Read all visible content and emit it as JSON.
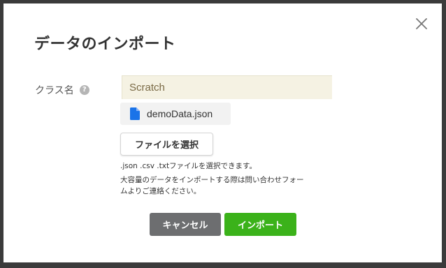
{
  "dialog": {
    "title": "データのインポート",
    "close_icon": "close-icon"
  },
  "form": {
    "class_name_label": "クラス名",
    "help_icon_text": "?",
    "class_name_value": "Scratch",
    "file": {
      "icon": "file-icon",
      "icon_color": "#1a73e8",
      "name": "demoData.json"
    },
    "choose_file_label": "ファイルを選択",
    "hint_formats": ".json .csv .txtファイルを選択できます。",
    "hint_contact_line1": "大容量のデータをインポートする際は問い合わせフォー",
    "hint_contact_line2": "ムよりご連絡ください。"
  },
  "actions": {
    "cancel_label": "キャンセル",
    "import_label": "インポート",
    "cancel_color": "#6d6e70",
    "import_color": "#3bb21a"
  }
}
